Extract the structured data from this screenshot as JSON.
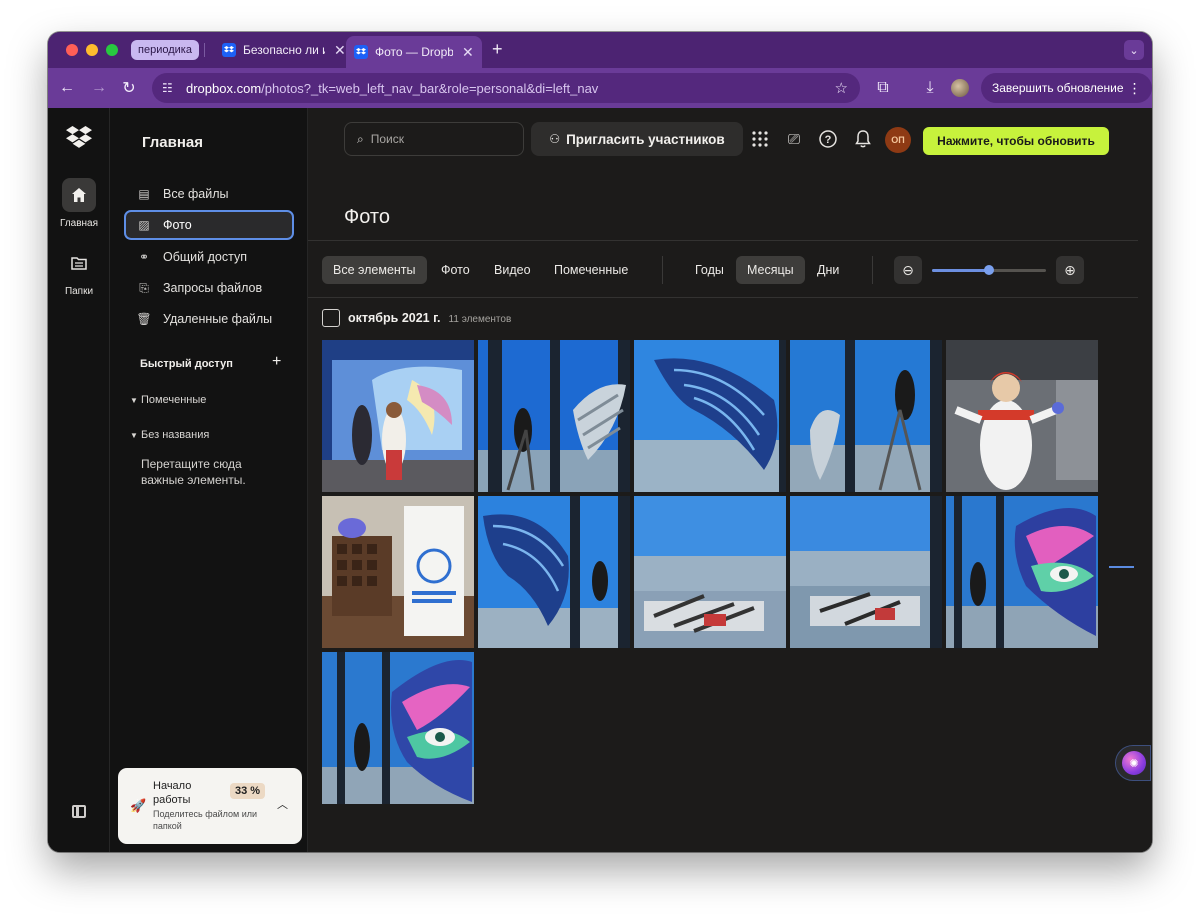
{
  "browser": {
    "tab_group": "периодика",
    "tabs": [
      {
        "title": "Безопасно ли и",
        "active": false
      },
      {
        "title": "Фото — Dropbo",
        "active": true
      }
    ],
    "new_tab": "+",
    "url_host": "dropbox.com",
    "url_rest": "/photos?_tk=web_left_nav_bar&role=personal&di=left_nav",
    "update_button": "Завершить обновление"
  },
  "rail": {
    "items": [
      {
        "label": "Главная",
        "icon": "home-icon",
        "selected": true
      },
      {
        "label": "Папки",
        "icon": "folder-icon",
        "selected": false
      }
    ]
  },
  "sidebar": {
    "title": "Главная",
    "items": [
      {
        "label": "Все файлы",
        "icon": "files-icon",
        "selected": false
      },
      {
        "label": "Фото",
        "icon": "photo-icon",
        "selected": true
      },
      {
        "label": "Общий доступ",
        "icon": "share-icon",
        "selected": false
      },
      {
        "label": "Запросы файлов",
        "icon": "file-request-icon",
        "selected": false
      },
      {
        "label": "Удаленные файлы",
        "icon": "trash-icon",
        "selected": false
      }
    ],
    "quick_access": "Быстрый доступ",
    "sections": [
      "Помеченные",
      "Без названия"
    ],
    "hint": "Перетащите сюда важные элементы.",
    "onboarding": {
      "title": "Начало работы",
      "percent": "33 %",
      "subtitle": "Поделитесь файлом или папкой"
    }
  },
  "topbar": {
    "search_placeholder": "Поиск",
    "invite_label": "Пригласить участников",
    "avatar_initials": "ОП",
    "update_label": "Нажмите, чтобы обновить"
  },
  "main": {
    "title": "Фото",
    "filters": [
      "Все элементы",
      "Фото",
      "Видео",
      "Помеченные"
    ],
    "selected_filter": "Все элементы",
    "granularity": [
      "Годы",
      "Месяцы",
      "Дни"
    ],
    "selected_granularity": "Месяцы",
    "zoom_level": 0.5,
    "month": {
      "label": "октябрь 2021 г.",
      "count": "11 элементов"
    },
    "photos": [
      {
        "subject": "artists painting a wing mural on a screen"
      },
      {
        "subject": "painter on ladder drawing a wing on glass"
      },
      {
        "subject": "blue ornamental wing painted on glass over city"
      },
      {
        "subject": "painter on ladder at skyscraper window"
      },
      {
        "subject": "person in white costume with red hair"
      },
      {
        "subject": "chocolate tray with a printed brochure"
      },
      {
        "subject": "blue wing mural with city view"
      },
      {
        "subject": "art supplies on table by window"
      },
      {
        "subject": "paint tubes and brushes on a table"
      },
      {
        "subject": "painters working on colorful eye-and-wing mural"
      },
      {
        "subject": "colorful eye-and-wing mural on glass"
      }
    ]
  },
  "colors": {
    "browser_frame": "#4c2372",
    "address_bar": "#6a3b98",
    "update_button": "#c7f23c",
    "selection_outline": "#5e8ee6",
    "avatar": "#8e3a14"
  }
}
